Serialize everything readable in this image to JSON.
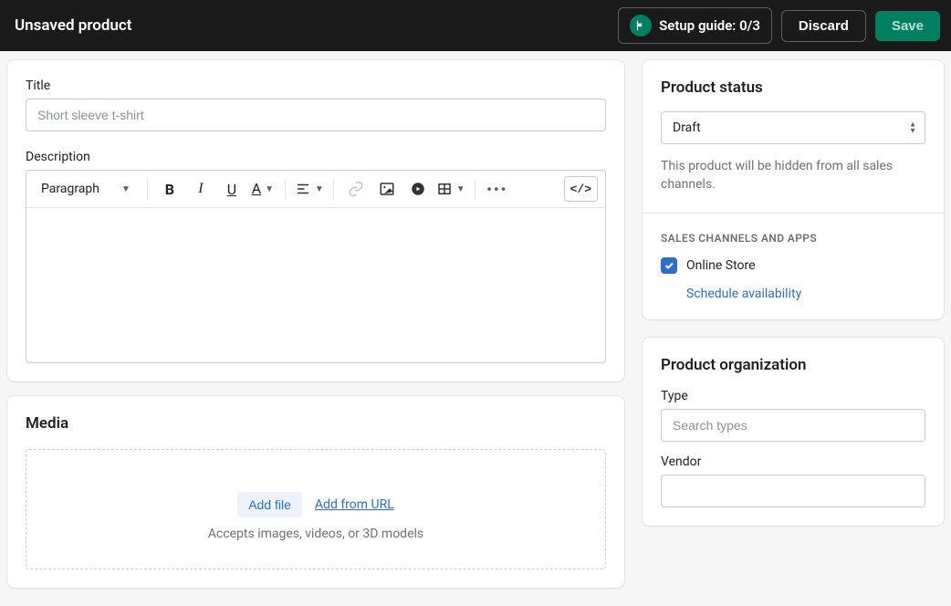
{
  "topbar": {
    "title": "Unsaved product",
    "setup_guide_label": "Setup guide: 0/3",
    "discard_label": "Discard",
    "save_label": "Save"
  },
  "main": {
    "title_label": "Title",
    "title_placeholder": "Short sleeve t-shirt",
    "title_value": "",
    "description_label": "Description",
    "editor": {
      "paragraph_label": "Paragraph",
      "code_label": "</>"
    },
    "media": {
      "heading": "Media",
      "add_file_label": "Add file",
      "add_from_url_label": "Add from URL",
      "hint": "Accepts images, videos, or 3D models"
    }
  },
  "side": {
    "status": {
      "heading": "Product status",
      "select_value": "Draft",
      "help_text": "This product will be hidden from all sales channels."
    },
    "channels": {
      "subhead": "SALES CHANNELS AND APPS",
      "online_store_label": "Online Store",
      "schedule_label": "Schedule availability"
    },
    "org": {
      "heading": "Product organization",
      "type_label": "Type",
      "type_placeholder": "Search types",
      "vendor_label": "Vendor"
    }
  }
}
